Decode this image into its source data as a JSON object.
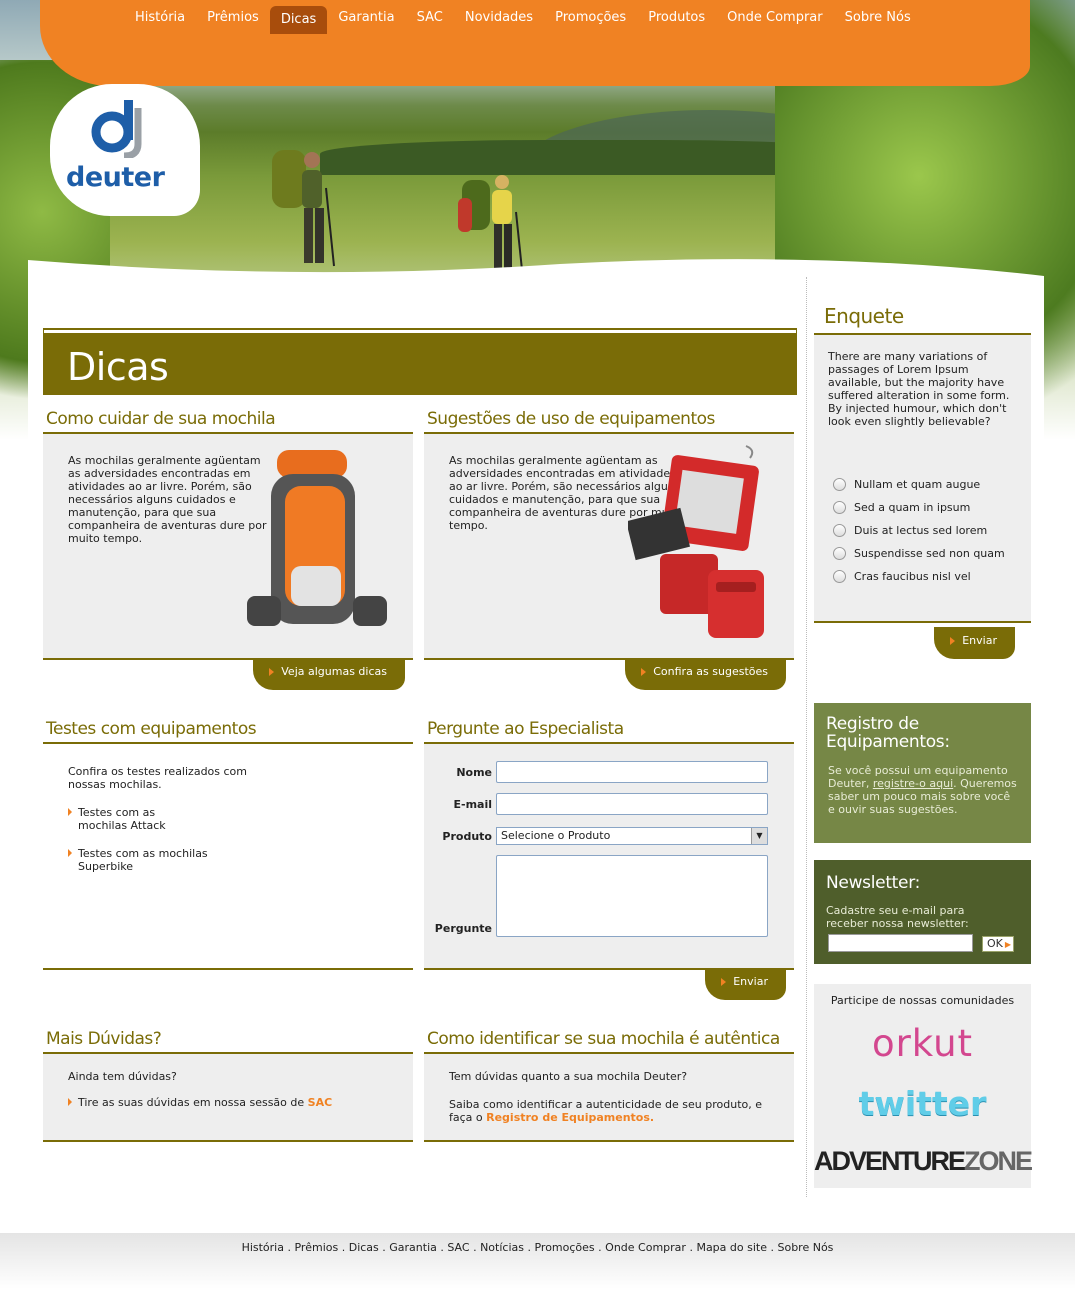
{
  "nav": {
    "items": [
      {
        "label": "História"
      },
      {
        "label": "Prêmios"
      },
      {
        "label": "Dicas",
        "active": true
      },
      {
        "label": "Garantia"
      },
      {
        "label": "SAC"
      },
      {
        "label": "Novidades"
      },
      {
        "label": "Promoções"
      },
      {
        "label": "Produtos"
      },
      {
        "label": "Onde Comprar"
      },
      {
        "label": "Sobre Nós"
      }
    ]
  },
  "logo": {
    "text": "deuter"
  },
  "page": {
    "title": "Dicas"
  },
  "care": {
    "title": "Como cuidar de sua mochila",
    "text": "As mochilas geralmente agüentam as adversidades encontradas em atividades ao ar livre. Porém, são necessários alguns cuidados e manutenção, para que sua companheira de aventuras dure por muito tempo.",
    "button": "Veja algumas dicas"
  },
  "suggest": {
    "title": "Sugestões de uso de equipamentos",
    "text": "As mochilas geralmente agüentam as adversidades encontradas em atividades ao ar livre. Porém, são necessários alguns cuidados e manutenção, para que sua companheira de aventuras dure por muito tempo.",
    "button": "Confira as sugestões"
  },
  "tests": {
    "title": "Testes com equipamentos",
    "intro": "Confira os testes realizados com nossas mochilas.",
    "links": [
      "Testes com as mochilas Attack",
      "Testes com as mochilas Superbike"
    ]
  },
  "ask": {
    "title": "Pergunte ao Especialista",
    "name_label": "Nome",
    "email_label": "E-mail",
    "product_label": "Produto",
    "product_selected": "Selecione o Produto",
    "question_label": "Pergunte",
    "button": "Enviar"
  },
  "doubts": {
    "title": "Mais Dúvidas?",
    "text": "Ainda tem dúvidas?",
    "link_prefix": "Tire as suas dúvidas em nossa sessão de ",
    "link": "SAC"
  },
  "authentic": {
    "title": "Como identificar se sua mochila é autêntica",
    "text1": "Tem dúvidas quanto a sua mochila Deuter?",
    "text2": "Saiba como identificar a autenticidade de seu produto, e faça o ",
    "link": "Registro de Equipamentos."
  },
  "poll": {
    "title": "Enquete",
    "question_1": "There are many variations of passages of Lorem Ipsum available, but the majority have suffered alteration in some form.",
    "question_2": "By injected humour, which don't look even slightly believable?",
    "options": [
      "Nullam et quam augue",
      "Sed a quam in ipsum",
      "Duis at lectus sed lorem",
      "Suspendisse sed non quam",
      "Cras faucibus nisl vel"
    ],
    "button": "Enviar"
  },
  "registry": {
    "title": "Registro de Equipamentos:",
    "text_prefix": "Se você possui um equipamento Deuter, ",
    "link": "registre-o aqui",
    "text_suffix": ". Queremos saber um pouco mais sobre você e ouvir suas sugestões."
  },
  "newsletter": {
    "title": "Newsletter:",
    "text": "Cadastre seu e-mail para receber nossa newsletter:",
    "button": "OK"
  },
  "communities": {
    "title": "Participe de nossas comunidades",
    "orkut": "orkut",
    "twitter": "twitter",
    "adventure_1": "ADVENTURE",
    "adventure_2": "ZONE"
  },
  "footer": {
    "links": [
      "História",
      "Prêmios",
      "Dicas",
      "Garantia",
      "SAC",
      "Notícias",
      "Promoções",
      "Onde Comprar",
      "Mapa do site",
      "Sobre Nós"
    ]
  },
  "colors": {
    "orange": "#f08223",
    "olive": "#7a6c07",
    "green": "#768746",
    "dark_green": "#4f5e2b",
    "brand_blue": "#1e5ea8"
  }
}
